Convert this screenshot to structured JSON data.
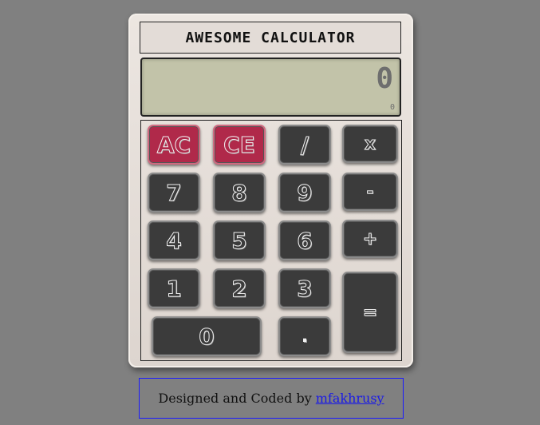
{
  "calculator": {
    "title": "AWESOME CALCULATOR",
    "display": {
      "value": "0",
      "history": "0"
    },
    "keys": {
      "ac": "AC",
      "ce": "CE",
      "divide": "/",
      "multiply": "x",
      "seven": "7",
      "eight": "8",
      "nine": "9",
      "minus": "-",
      "four": "4",
      "five": "5",
      "six": "6",
      "plus": "+",
      "one": "1",
      "two": "2",
      "three": "3",
      "equals": "=",
      "zero": "0",
      "decimal": "."
    },
    "colors": {
      "body": "#e3dcd7",
      "screen": "#c2c3a9",
      "key": "#3b3b3b",
      "clear_key": "#b0294a"
    }
  },
  "footer": {
    "text": "Designed and Coded by",
    "author_link": "mfakhrusy"
  }
}
